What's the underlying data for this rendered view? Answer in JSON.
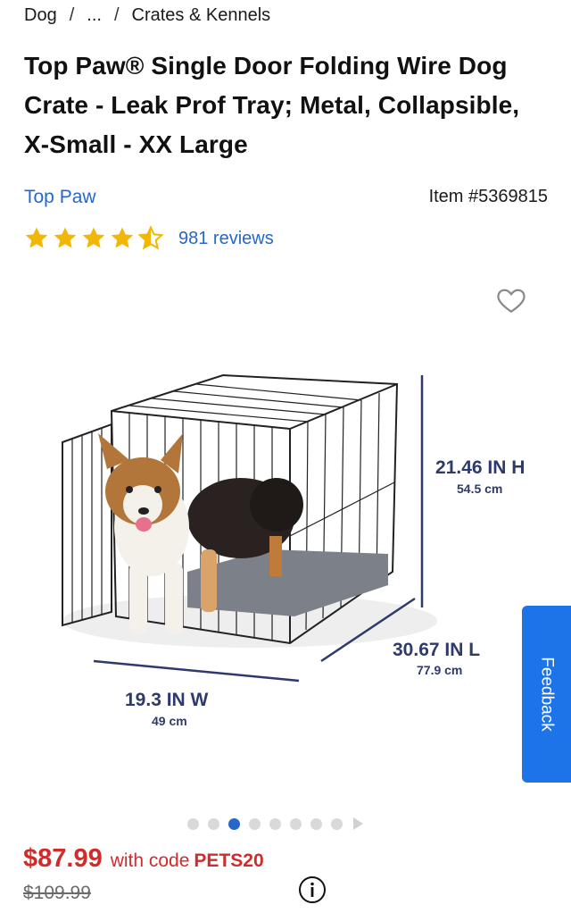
{
  "breadcrumb": {
    "items": [
      "Dog",
      "...",
      "Crates & Kennels"
    ],
    "separator": "/"
  },
  "product": {
    "title": "Top Paw® Single Door Folding Wire Dog Crate - Leak Prof Tray; Metal, Collapsible, X-Small - XX Large",
    "brand": "Top Paw",
    "item_number": "Item #5369815",
    "rating": 4.5,
    "reviews": "981 reviews"
  },
  "image": {
    "dims": {
      "height_in": "21.46 IN H",
      "height_cm": "54.5 cm",
      "length_in": "30.67 IN L",
      "length_cm": "77.9 cm",
      "width_in": "19.3 IN W",
      "width_cm": "49 cm"
    },
    "carousel": {
      "count": 8,
      "active": 3
    }
  },
  "feedback": {
    "label": "Feedback"
  },
  "pricing": {
    "price": "$87.99",
    "with_code": "with code",
    "code": "PETS20",
    "original": "$109.99"
  },
  "colors": {
    "link": "#2767c7",
    "price": "#d22b2b",
    "star": "#f2b705",
    "feedback_bg": "#1d73e8",
    "dimension_text": "#2e3a6b"
  },
  "icons": [
    "heart-icon",
    "star-icon",
    "info-icon",
    "chevron-right-icon"
  ]
}
